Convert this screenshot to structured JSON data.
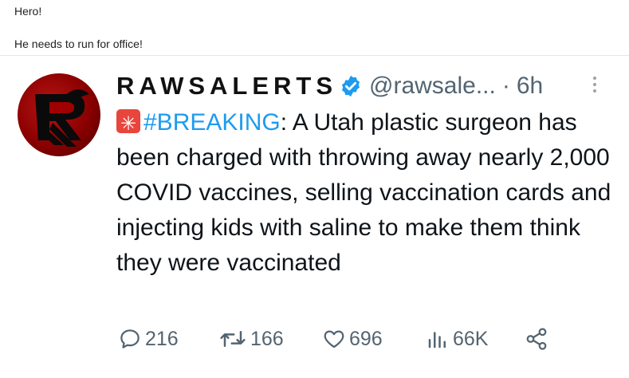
{
  "comments": [
    "Hero!",
    "He needs to run for office!"
  ],
  "tweet": {
    "display_name": "RAWSALERTS",
    "handle": "@rawsale...",
    "separator": "·",
    "time": "6h",
    "hashtag": "#BREAKING",
    "text_rest": ": A Utah plastic surgeon has been charged with throwing away nearly 2,000 COVID vaccines, selling vaccination cards and injecting kids with saline to make them think they were vaccinated",
    "emoji": "rotating-light-siren",
    "stats": {
      "replies": "216",
      "retweets": "166",
      "likes": "696",
      "views": "66K"
    },
    "colors": {
      "link": "#1d9bf0",
      "verified": "#1d9bf0",
      "muted": "#536471",
      "avatar_bg": "#8a0000"
    }
  }
}
